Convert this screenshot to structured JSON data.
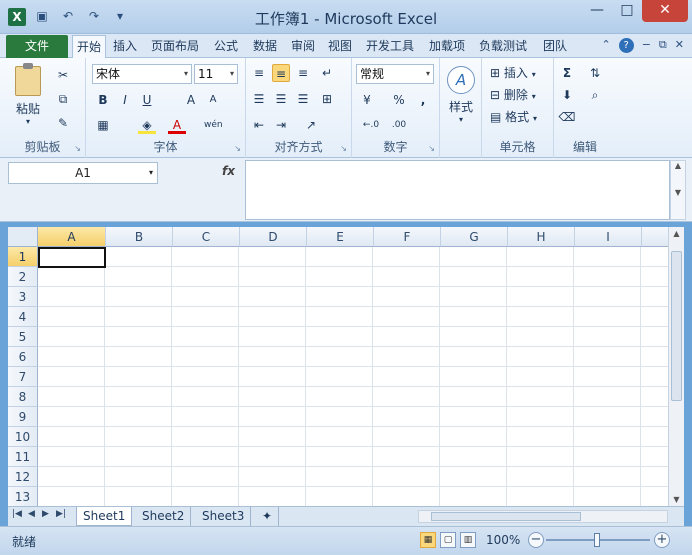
{
  "window": {
    "title": "工作簿1 - Microsoft Excel",
    "app_icon_letter": "X",
    "qat_icons": [
      "save-icon",
      "undo-icon",
      "redo-icon",
      "customize-icon"
    ]
  },
  "tabs": {
    "file": "文件",
    "items": [
      "开始",
      "插入",
      "页面布局",
      "公式",
      "数据",
      "审阅",
      "视图",
      "开发工具",
      "加载项",
      "负载测试",
      "团队"
    ],
    "active": "开始",
    "help": "?"
  },
  "ribbon": {
    "clipboard": {
      "label": "剪贴板",
      "paste": "粘贴"
    },
    "font": {
      "label": "字体",
      "font_name": "宋体",
      "font_size": "11",
      "bold": "B",
      "italic": "I",
      "underline": "U",
      "grow": "A",
      "shrink": "A",
      "phonetic": "wén",
      "font_color_letter": "A"
    },
    "alignment": {
      "label": "对齐方式"
    },
    "number": {
      "label": "数字",
      "format": "常规",
      "percent": "%",
      "comma": ",",
      "inc_decimal": "←.0",
      "dec_decimal": ".00"
    },
    "styles": {
      "label": "样式",
      "button": "样式"
    },
    "cells": {
      "label": "单元格",
      "insert": "插入",
      "delete": "删除",
      "format": "格式"
    },
    "editing": {
      "label": "编辑",
      "sum": "Σ"
    }
  },
  "formula_bar": {
    "name_box": "A1",
    "fx": "fx",
    "value": ""
  },
  "grid": {
    "columns": [
      "A",
      "B",
      "C",
      "D",
      "E",
      "F",
      "G",
      "H",
      "I"
    ],
    "rows": [
      "1",
      "2",
      "3",
      "4",
      "5",
      "6",
      "7",
      "8",
      "9",
      "10",
      "11",
      "12",
      "13"
    ],
    "active_cell": "A1"
  },
  "sheets": {
    "nav": [
      "|◀",
      "◀",
      "▶",
      "▶|"
    ],
    "tabs": [
      "Sheet1",
      "Sheet2",
      "Sheet3"
    ],
    "active": "Sheet1"
  },
  "status": {
    "mode": "就绪",
    "zoom": "100%",
    "zoom_out": "−",
    "zoom_in": "+"
  }
}
